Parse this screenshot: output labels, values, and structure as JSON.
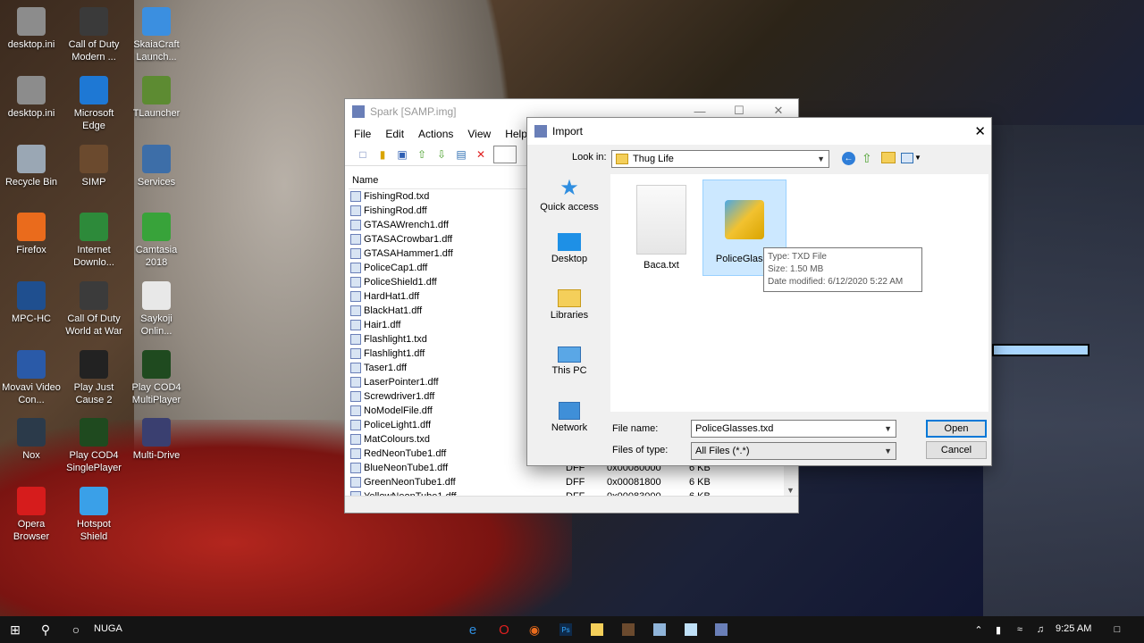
{
  "desktop": {
    "icons": [
      {
        "label": "desktop.ini",
        "icon": "settings-file-icon",
        "color": "#8c8c8c"
      },
      {
        "label": "Call of Duty Modern ...",
        "icon": "cod-modern-icon",
        "color": "#3a3a3a"
      },
      {
        "label": "SkaiaCraft Launch...",
        "icon": "skaiacraft-icon",
        "color": "#3b8fe0"
      },
      {
        "label": "desktop.ini",
        "icon": "settings-file-icon",
        "color": "#8c8c8c"
      },
      {
        "label": "Microsoft Edge",
        "icon": "edge-icon",
        "color": "#1e78d4"
      },
      {
        "label": "TLauncher",
        "icon": "tlauncher-icon",
        "color": "#5d8b32"
      },
      {
        "label": "Recycle Bin",
        "icon": "recycle-bin-icon",
        "color": "#9aa7b4"
      },
      {
        "label": "SIMP",
        "icon": "simp-icon",
        "color": "#6b4a2e"
      },
      {
        "label": "Services",
        "icon": "gear-icon",
        "color": "#3d6ea8"
      },
      {
        "label": "Firefox",
        "icon": "firefox-icon",
        "color": "#ea6b1c"
      },
      {
        "label": "Internet Downlo...",
        "icon": "idm-icon",
        "color": "#2d8a3a"
      },
      {
        "label": "Camtasia 2018",
        "icon": "camtasia-icon",
        "color": "#38a33a"
      },
      {
        "label": "MPC-HC",
        "icon": "mpc-hc-icon",
        "color": "#1f4f8f"
      },
      {
        "label": "Call Of Duty World at War",
        "icon": "cod-waw-icon",
        "color": "#3b3b3b"
      },
      {
        "label": "Saykoji Onlin...",
        "icon": "text-file-icon",
        "color": "#e8e8e8"
      },
      {
        "label": "Movavi Video Con...",
        "icon": "movavi-icon",
        "color": "#2a5aa8"
      },
      {
        "label": "Play Just Cause 2",
        "icon": "just-cause-icon",
        "color": "#222222"
      },
      {
        "label": "Play COD4 MultiPlayer",
        "icon": "cod4-icon",
        "color": "#1f4a1f"
      },
      {
        "label": "Nox",
        "icon": "nox-icon",
        "color": "#2b3a4a"
      },
      {
        "label": "Play COD4 SinglePlayer",
        "icon": "cod4-icon",
        "color": "#1f4a1f"
      },
      {
        "label": "Multi-Drive",
        "icon": "multi-drive-icon",
        "color": "#3a3f70"
      },
      {
        "label": "Opera Browser",
        "icon": "opera-icon",
        "color": "#d61c1c"
      },
      {
        "label": "Hotspot Shield",
        "icon": "hotspot-shield-icon",
        "color": "#3aa0e8"
      }
    ]
  },
  "spark": {
    "title": "Spark [SAMP.img]",
    "menu": [
      "File",
      "Edit",
      "Actions",
      "View",
      "Help"
    ],
    "column_name": "Name",
    "files": [
      {
        "name": "FishingRod.txd",
        "type": "",
        "offset": "",
        "size": ""
      },
      {
        "name": "FishingRod.dff",
        "type": "",
        "offset": "",
        "size": ""
      },
      {
        "name": "GTASAWrench1.dff",
        "type": "",
        "offset": "",
        "size": ""
      },
      {
        "name": "GTASACrowbar1.dff",
        "type": "",
        "offset": "",
        "size": ""
      },
      {
        "name": "GTASAHammer1.dff",
        "type": "",
        "offset": "",
        "size": ""
      },
      {
        "name": "PoliceCap1.dff",
        "type": "",
        "offset": "",
        "size": ""
      },
      {
        "name": "PoliceShield1.dff",
        "type": "",
        "offset": "",
        "size": ""
      },
      {
        "name": "HardHat1.dff",
        "type": "",
        "offset": "",
        "size": ""
      },
      {
        "name": "BlackHat1.dff",
        "type": "",
        "offset": "",
        "size": ""
      },
      {
        "name": "Hair1.dff",
        "type": "",
        "offset": "",
        "size": ""
      },
      {
        "name": "Flashlight1.txd",
        "type": "",
        "offset": "",
        "size": ""
      },
      {
        "name": "Flashlight1.dff",
        "type": "",
        "offset": "",
        "size": ""
      },
      {
        "name": "Taser1.dff",
        "type": "",
        "offset": "",
        "size": ""
      },
      {
        "name": "LaserPointer1.dff",
        "type": "",
        "offset": "",
        "size": ""
      },
      {
        "name": "Screwdriver1.dff",
        "type": "",
        "offset": "",
        "size": ""
      },
      {
        "name": "NoModelFile.dff",
        "type": "",
        "offset": "",
        "size": ""
      },
      {
        "name": "PoliceLight1.dff",
        "type": "",
        "offset": "",
        "size": ""
      },
      {
        "name": "MatColours.txd",
        "type": "",
        "offset": "",
        "size": ""
      },
      {
        "name": "RedNeonTube1.dff",
        "type": "",
        "offset": "",
        "size": ""
      },
      {
        "name": "BlueNeonTube1.dff",
        "type": "DFF",
        "offset": "0x00080000",
        "size": "6 KB"
      },
      {
        "name": "GreenNeonTube1.dff",
        "type": "DFF",
        "offset": "0x00081800",
        "size": "6 KB"
      },
      {
        "name": "YellowNeonTube1.dff",
        "type": "DFF",
        "offset": "0x00083000",
        "size": "6 KB"
      }
    ]
  },
  "dialog": {
    "title": "Import",
    "look_in_label": "Look in:",
    "look_in_value": "Thug Life",
    "places": [
      {
        "label": "Quick access",
        "icon": "star-icon"
      },
      {
        "label": "Desktop",
        "icon": "desktop-icon"
      },
      {
        "label": "Libraries",
        "icon": "libraries-icon"
      },
      {
        "label": "This PC",
        "icon": "computer-icon"
      },
      {
        "label": "Network",
        "icon": "network-icon"
      }
    ],
    "files": [
      {
        "label": "Baca.txt",
        "icon": "text-document-icon"
      },
      {
        "label": "PoliceGlasse",
        "icon": "txd-file-icon"
      }
    ],
    "tooltip": {
      "type": "Type: TXD File",
      "size": "Size: 1.50 MB",
      "modified": "Date modified: 6/12/2020 5:22 AM"
    },
    "file_name_label": "File name:",
    "file_name_value": "PoliceGlasses.txd",
    "file_type_label": "Files of type:",
    "file_type_value": "All Files (*.*)",
    "open_button": "Open",
    "cancel_button": "Cancel"
  },
  "taskbar": {
    "search_text": "NUGA",
    "clock": "9:25 AM"
  }
}
